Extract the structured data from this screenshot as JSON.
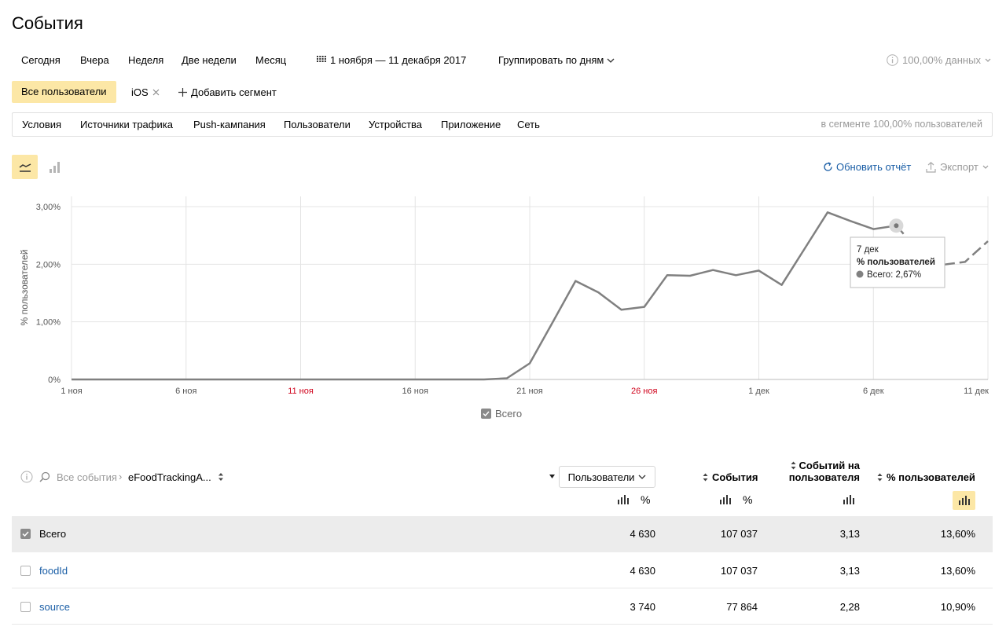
{
  "page": {
    "title": "События"
  },
  "periods": [
    "Сегодня",
    "Вчера",
    "Неделя",
    "Две недели",
    "Месяц"
  ],
  "date_range": "1 ноября — 11 декабря 2017",
  "group_by": "Группировать по дням",
  "data_sample": "100,00% данных",
  "segments": {
    "active": "Все пользователи",
    "ios": "iOS",
    "add": "Добавить сегмент"
  },
  "filters": {
    "tabs": [
      "Условия",
      "Источники трафика",
      "Push-кампания",
      "Пользователи",
      "Устройства",
      "Приложение",
      "Сеть"
    ],
    "segment_info": "в сегменте 100,00% пользователей"
  },
  "toolbar": {
    "refresh": "Обновить отчёт",
    "export": "Экспорт"
  },
  "chart_data": {
    "type": "line",
    "ylabel": "% пользователей",
    "yticks": [
      "0%",
      "1,00%",
      "2,00%",
      "3,00%"
    ],
    "ylim": [
      0,
      3.0
    ],
    "xticks": [
      "1 ноя",
      "6 ноя",
      "11 ноя",
      "16 ноя",
      "21 ноя",
      "26 ноя",
      "1 дек",
      "6 дек",
      "11 дек"
    ],
    "weekend_ticks": [
      "11 ноя",
      "26 ноя"
    ],
    "grid": true,
    "legend_position": "bottom-center",
    "series": [
      {
        "name": "Всего",
        "color": "#808080",
        "x": [
          "2017-11-01",
          "2017-11-02",
          "2017-11-03",
          "2017-11-04",
          "2017-11-05",
          "2017-11-06",
          "2017-11-07",
          "2017-11-08",
          "2017-11-09",
          "2017-11-10",
          "2017-11-11",
          "2017-11-12",
          "2017-11-13",
          "2017-11-14",
          "2017-11-15",
          "2017-11-16",
          "2017-11-17",
          "2017-11-18",
          "2017-11-19",
          "2017-11-20",
          "2017-11-21",
          "2017-11-22",
          "2017-11-23",
          "2017-11-24",
          "2017-11-25",
          "2017-11-26",
          "2017-11-27",
          "2017-11-28",
          "2017-11-29",
          "2017-11-30",
          "2017-12-01",
          "2017-12-02",
          "2017-12-03",
          "2017-12-04",
          "2017-12-05",
          "2017-12-06",
          "2017-12-07",
          "2017-12-08",
          "2017-12-09",
          "2017-12-10",
          "2017-12-11"
        ],
        "values": [
          0,
          0,
          0,
          0,
          0,
          0,
          0,
          0,
          0,
          0,
          0,
          0,
          0,
          0,
          0,
          0,
          0,
          0,
          0,
          0.02,
          0.28,
          0.99,
          1.71,
          1.51,
          1.21,
          1.26,
          1.81,
          1.8,
          1.9,
          1.81,
          1.89,
          1.64,
          2.27,
          2.9,
          2.75,
          2.61,
          2.67,
          2.22,
          1.99,
          2.04,
          2.4
        ]
      }
    ],
    "dashed_from": "2017-12-07",
    "tooltip": {
      "date": "7 дек",
      "metric": "% пользователей",
      "series": "Всего",
      "value": "2,67%",
      "index": 36
    }
  },
  "table": {
    "path": {
      "root": "Все события",
      "current": "eFoodTrackingA..."
    },
    "metric_select": "Пользователи",
    "columns": {
      "events": "События",
      "per_user": "Событий на пользователя",
      "pct_users": "% пользователей"
    },
    "pct_symbol": "%",
    "rows": [
      {
        "name": "Всего",
        "checked": true,
        "users": "4 630",
        "events": "107 037",
        "per_user": "3,13",
        "pct": "13,60%"
      },
      {
        "name": "foodId",
        "checked": false,
        "users": "4 630",
        "events": "107 037",
        "per_user": "3,13",
        "pct": "13,60%"
      },
      {
        "name": "source",
        "checked": false,
        "users": "3 740",
        "events": "77 864",
        "per_user": "2,28",
        "pct": "10,90%"
      }
    ]
  }
}
